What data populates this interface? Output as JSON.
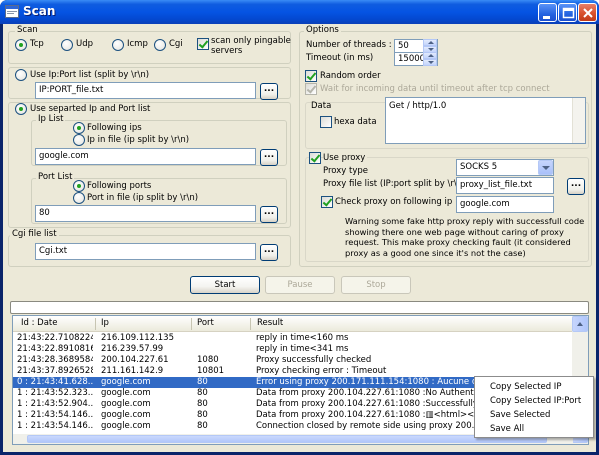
{
  "window": {
    "title": "Scan"
  },
  "scan": {
    "title": "Scan",
    "protocols": [
      {
        "label": "Tcp",
        "selected": true
      },
      {
        "label": "Udp",
        "selected": false
      },
      {
        "label": "Icmp",
        "selected": false
      },
      {
        "label": "Cgi",
        "selected": false
      }
    ],
    "pingable_label": "scan only pingable servers",
    "pingable_line1": "scan only pingable",
    "pingable_line2": "servers",
    "pingable_checked": true
  },
  "ip_port_list": {
    "label": "Use Ip:Port list (split by \\r\\n)",
    "value": "IP:PORT_file.txt"
  },
  "separated": {
    "label": "Use separted  Ip and Port list",
    "ip_list": {
      "title": "Ip List",
      "following_label": "Following ips",
      "file_label": "Ip in file (ip split by \\r\\n)",
      "value": "google.com"
    },
    "port_list": {
      "title": "Port List",
      "following_label": "Following ports",
      "file_label": "Port in file (ip split by \\r\\n)",
      "value": "80"
    }
  },
  "cgi": {
    "title": "Cgi file list",
    "value": "Cgi.txt"
  },
  "browse_label": "...",
  "options": {
    "title": "Options",
    "threads_label": "Number of threads :",
    "threads_value": "50",
    "timeout_label": "Timeout (in ms)",
    "timeout_value": "15000",
    "random_order_label": "Random order",
    "wait_label": "Wait for incoming data until timeout after tcp connect",
    "data_label": "Data",
    "hexa_label": "hexa data",
    "data_value": "Get / http/1.0",
    "use_proxy_label": "Use proxy",
    "proxy_type_label": "Proxy type",
    "proxy_type_value": "SOCKS 5",
    "proxy_file_label": "Proxy file list (IP:port split by \\r\\n)",
    "proxy_file_value": "proxy_list_file.txt",
    "check_proxy_label": "Check proxy on following ip",
    "check_proxy_value": "google.com",
    "warning": "Warning some fake http proxy reply with successfull code showing there one web page without caring of proxy request. This make proxy checking fault (it considered proxy as a good one since it's not the case)"
  },
  "buttons": {
    "start": "Start",
    "pause": "Pause",
    "stop": "Stop"
  },
  "results": {
    "columns": [
      "Id : Date",
      "Ip",
      "Port",
      "Result"
    ],
    "rows": [
      {
        "id": "21:43:22.7108224",
        "ip": "216.109.112.135",
        "port": "",
        "result": "reply in time<160 ms",
        "selected": false
      },
      {
        "id": "21:43:22.8910816",
        "ip": "216.239.57.99",
        "port": "",
        "result": "reply in time<341 ms",
        "selected": false
      },
      {
        "id": "21:43:28.3689584",
        "ip": "200.104.227.61",
        "port": "1080",
        "result": "Proxy successfully checked",
        "selected": false
      },
      {
        "id": "21:43:37.8926528",
        "ip": "211.161.142.9",
        "port": "10801",
        "result": "Proxy checking error : Timeout",
        "selected": false
      },
      {
        "id": "0 : 21:43:41.628...",
        "ip": "google.com",
        "port": "80",
        "result": "Error using proxy 200.171.111.154:1080 : Aucune connexion",
        "selected": true
      },
      {
        "id": "1 : 21:43:52.323...",
        "ip": "google.com",
        "port": "80",
        "result": "Data from proxy 200.104.227.61:1080 :No Authentication a",
        "selected": false
      },
      {
        "id": "1 : 21:43:52.904...",
        "ip": "google.com",
        "port": "80",
        "result": "Data from proxy 200.104.227.61:1080 :Successfully Conne",
        "selected": false
      },
      {
        "id": "1 : 21:43:54.146...",
        "ip": "google.com",
        "port": "80",
        "result": "Data from proxy 200.104.227.61:1080 :▥<html><head>▥<titl",
        "selected": false
      },
      {
        "id": "1 : 21:43:54.146...",
        "ip": "google.com",
        "port": "80",
        "result": "Connection closed by remote side using proxy 200.104.227",
        "selected": false
      }
    ]
  },
  "context_menu": {
    "items": [
      "Copy Selected IP",
      "Copy Selected IP:Port",
      "Save Selected",
      "Save All"
    ]
  },
  "colors": {
    "titlebar": "#0554e3",
    "selection": "#316ac5",
    "dialog_bg": "#ece9d8",
    "radio_check_mark": "#21a121"
  },
  "icons": [
    "app-icon",
    "minimize-icon",
    "maximize-icon",
    "close-icon"
  ]
}
